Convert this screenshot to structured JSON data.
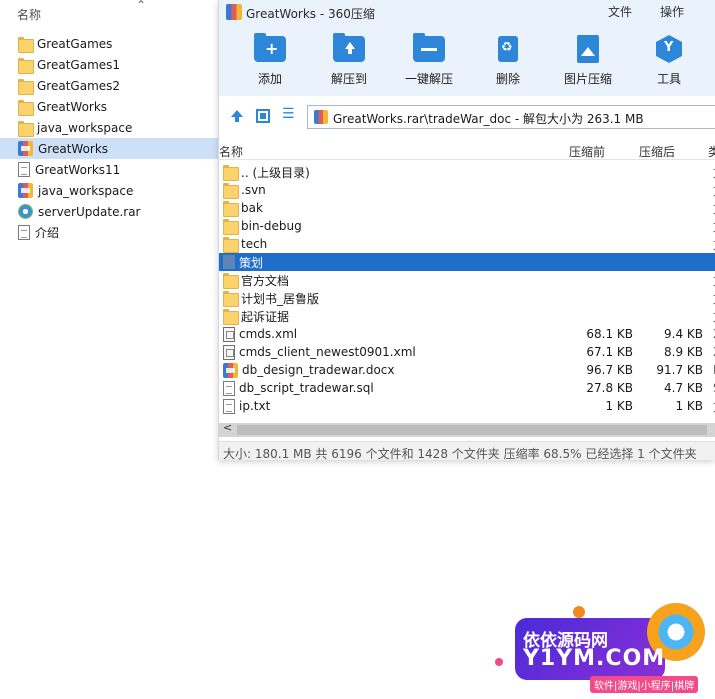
{
  "explorer": {
    "column_header": "名称",
    "items": [
      {
        "label": "GreatGames",
        "icon": "folder-icon"
      },
      {
        "label": "GreatGames1",
        "icon": "folder-icon"
      },
      {
        "label": "GreatGames2",
        "icon": "folder-icon"
      },
      {
        "label": "GreatWorks",
        "icon": "folder-icon"
      },
      {
        "label": "java_workspace",
        "icon": "folder-icon"
      },
      {
        "label": "GreatWorks",
        "icon": "rar-archive-icon",
        "selected": true
      },
      {
        "label": "GreatWorks11",
        "icon": "file-icon"
      },
      {
        "label": "java_workspace",
        "icon": "rar-archive-icon"
      },
      {
        "label": "serverUpdate.rar",
        "icon": "gear-icon"
      },
      {
        "label": "介绍",
        "icon": "text-file-icon"
      }
    ]
  },
  "window": {
    "title": "GreatWorks - 360压缩",
    "menu": [
      "文件",
      "操作"
    ],
    "accent": "#2d86d8",
    "toolbar": [
      {
        "label": "添加",
        "icon": "add-icon"
      },
      {
        "label": "解压到",
        "icon": "extract-to-icon"
      },
      {
        "label": "一键解压",
        "icon": "one-click-extract-icon"
      },
      {
        "label": "删除",
        "icon": "delete-icon"
      },
      {
        "label": "图片压缩",
        "icon": "image-compress-icon"
      },
      {
        "label": "工具",
        "icon": "tools-icon"
      }
    ],
    "address": "GreatWorks.rar\\tradeWar_doc - 解包大小为 263.1 MB",
    "columns": {
      "name": "名称",
      "compressed_before": "压缩前",
      "compressed_after": "压缩后",
      "extra": "类"
    },
    "files": [
      {
        "name": ".. (上级目录)",
        "icon": "folder-icon",
        "before": "",
        "after": ""
      },
      {
        "name": ".svn",
        "icon": "folder-icon",
        "before": "",
        "after": ""
      },
      {
        "name": "bak",
        "icon": "folder-icon",
        "before": "",
        "after": ""
      },
      {
        "name": "bin-debug",
        "icon": "folder-icon",
        "before": "",
        "after": ""
      },
      {
        "name": "tech",
        "icon": "folder-icon",
        "before": "",
        "after": ""
      },
      {
        "name": "策划",
        "icon": "folder-icon",
        "before": "",
        "after": "",
        "selected": true
      },
      {
        "name": "官方文档",
        "icon": "folder-icon",
        "before": "",
        "after": ""
      },
      {
        "name": "计划书_居鲁版",
        "icon": "folder-icon",
        "before": "",
        "after": ""
      },
      {
        "name": "起诉证据",
        "icon": "folder-icon",
        "before": "",
        "after": ""
      },
      {
        "name": "cmds.xml",
        "icon": "xml-file-icon",
        "before": "68.1 KB",
        "after": "9.4 KB"
      },
      {
        "name": "cmds_client_newest0901.xml",
        "icon": "xml-file-icon",
        "before": "67.1 KB",
        "after": "8.9 KB"
      },
      {
        "name": "db_design_tradewar.docx",
        "icon": "docx-file-icon",
        "before": "96.7 KB",
        "after": "91.7 KB"
      },
      {
        "name": "db_script_tradewar.sql",
        "icon": "file-icon",
        "before": "27.8 KB",
        "after": "4.7 KB"
      },
      {
        "name": "ip.txt",
        "icon": "text-file-icon",
        "before": "1 KB",
        "after": "1 KB"
      }
    ],
    "status": "大小: 180.1 MB 共 6196 个文件和 1428 个文件夹 压缩率 68.5% 已经选择 1 个文件夹"
  },
  "watermark": {
    "line1": "依依源码网",
    "line2": "Y1YM.COM",
    "line3": "软件|游戏|小程序|棋牌"
  }
}
